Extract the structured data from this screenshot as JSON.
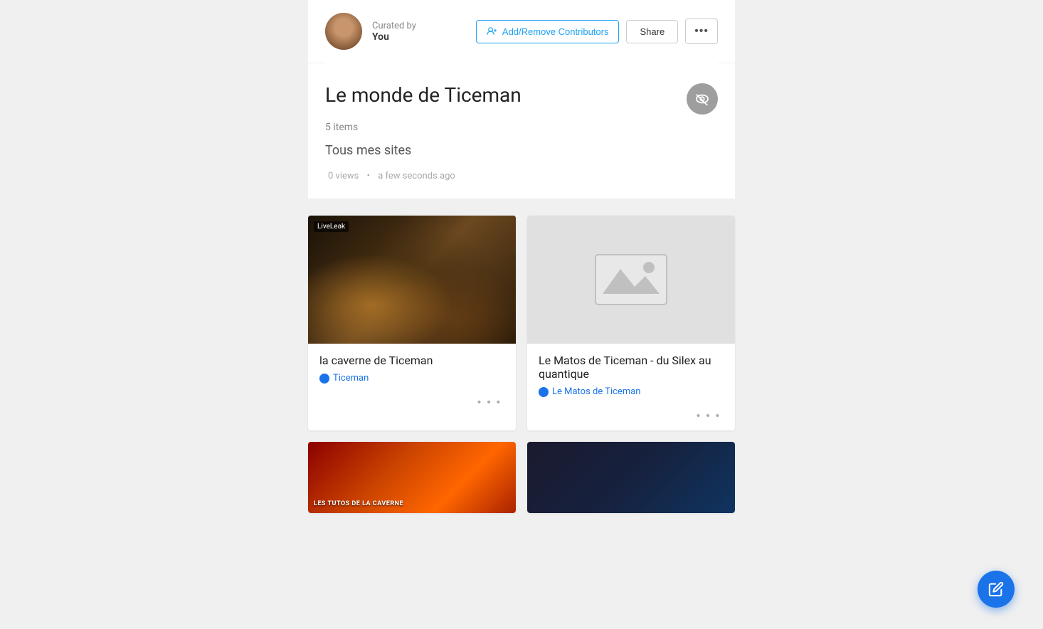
{
  "header": {
    "curated_by_label": "Curated by",
    "curated_by_name": "You",
    "add_contributors_label": "Add/Remove Contributors",
    "share_label": "Share",
    "more_label": "•••"
  },
  "collection": {
    "title": "Le monde de Ticeman",
    "items_count": "5 items",
    "description": "Tous mes sites",
    "views": "0 views",
    "dot_separator": "•",
    "timestamp": "a few seconds ago"
  },
  "cards": [
    {
      "title": "la caverne de Ticeman",
      "source": "Ticeman",
      "more": "• • •"
    },
    {
      "title": "Le Matos de Ticeman - du Silex au quantique",
      "source": "Le Matos de Ticeman",
      "more": "• • •"
    }
  ],
  "icons": {
    "contributors": "👥",
    "visibility_off": "👁",
    "globe": "🌐",
    "edit": "✏️"
  }
}
